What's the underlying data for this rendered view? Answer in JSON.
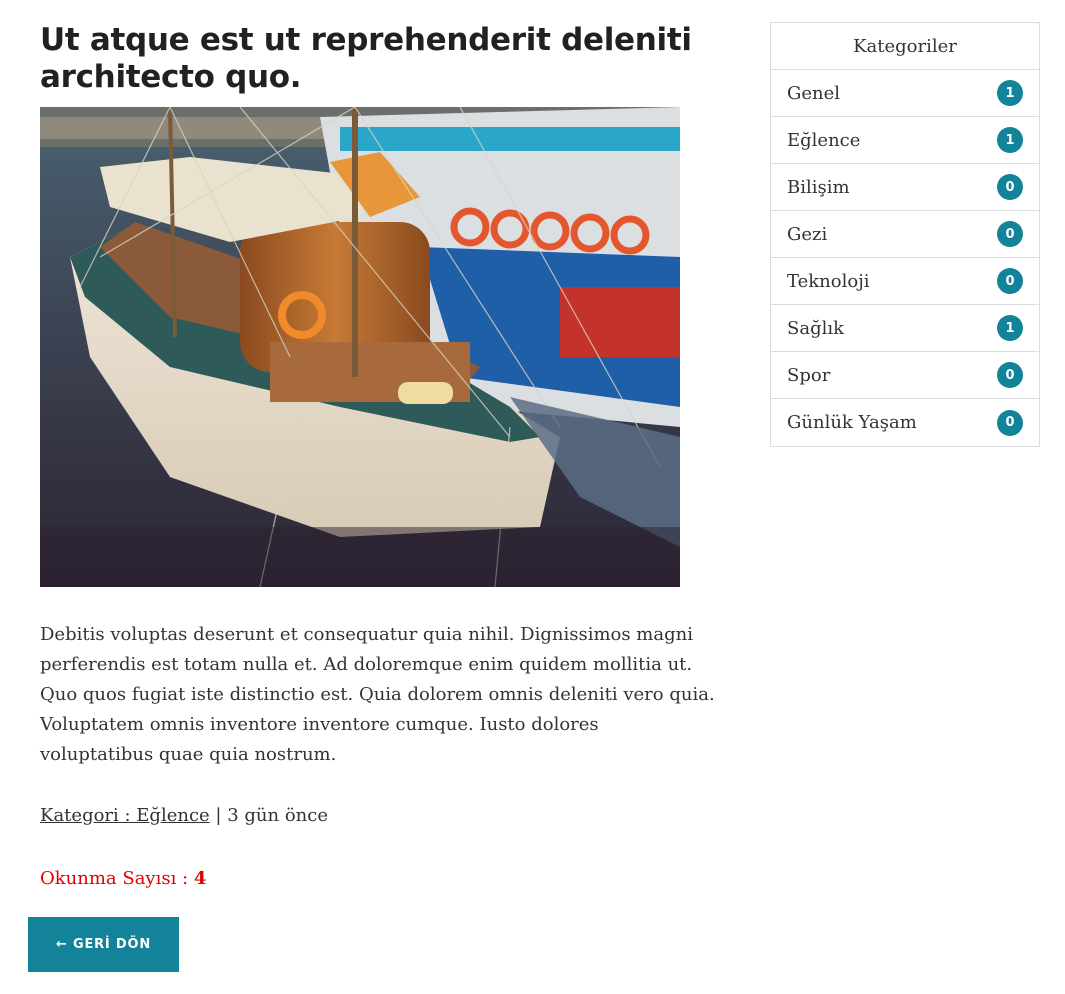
{
  "post": {
    "title": "Ut atque est ut reprehenderit deleniti architecto quo.",
    "image_alt": "sailboat in harbor",
    "body": "Debitis voluptas deserunt et consequatur quia nihil. Dignissimos magni perferendis est totam nulla et. Ad doloremque enim quidem mollitia ut. Quo quos fugiat iste distinctio est. Quia dolorem omnis deleniti vero quia. Voluptatem omnis inventore inventore cumque. Iusto dolores voluptatibus quae quia nostrum.",
    "category_link": "Kategori : Eğlence",
    "separator": " | ",
    "time_ago": "3 gün önce",
    "views_label": "Okunma Sayısı : ",
    "views_count": "4"
  },
  "back_button": {
    "label": "← GERİ DÖN"
  },
  "sidebar": {
    "title": "Kategoriler",
    "items": [
      {
        "label": "Genel",
        "count": "1"
      },
      {
        "label": "Eğlence",
        "count": "1"
      },
      {
        "label": "Bilişim",
        "count": "0"
      },
      {
        "label": "Gezi",
        "count": "0"
      },
      {
        "label": "Teknoloji",
        "count": "0"
      },
      {
        "label": "Sağlık",
        "count": "1"
      },
      {
        "label": "Spor",
        "count": "0"
      },
      {
        "label": "Günlük Yaşam",
        "count": "0"
      }
    ]
  },
  "colors": {
    "accent": "#128399",
    "views_text": "#e00000",
    "title_text": "#212121",
    "body_text": "#333333"
  }
}
